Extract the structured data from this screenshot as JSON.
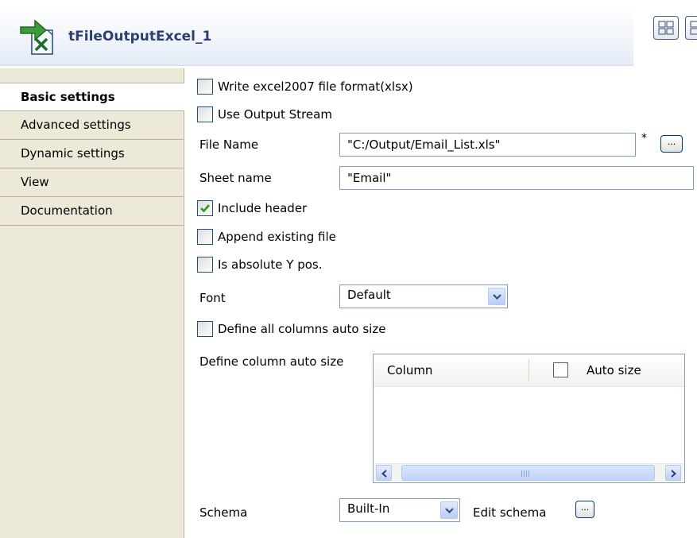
{
  "header": {
    "title": "tFileOutputExcel_1",
    "icons": [
      "component-icon",
      "layout-toggle-icon"
    ]
  },
  "tabs": [
    {
      "label": "Basic settings",
      "active": true
    },
    {
      "label": "Advanced settings",
      "active": false
    },
    {
      "label": "Dynamic settings",
      "active": false
    },
    {
      "label": "View",
      "active": false
    },
    {
      "label": "Documentation",
      "active": false
    }
  ],
  "form": {
    "write_excel2007": {
      "label": "Write excel2007 file format(xlsx)",
      "checked": false
    },
    "use_output_stream": {
      "label": "Use Output Stream",
      "checked": false
    },
    "file_name": {
      "label": "File Name",
      "value": "\"C:/Output/Email_List.xls\"",
      "required_mark": "*",
      "browse_label": "..."
    },
    "sheet_name": {
      "label": "Sheet name",
      "value": "\"Email\""
    },
    "include_header": {
      "label": "Include header",
      "checked": true
    },
    "append_existing": {
      "label": "Append existing file",
      "checked": false
    },
    "absolute_y": {
      "label": "Is absolute Y pos.",
      "checked": false
    },
    "font": {
      "label": "Font",
      "value": "Default"
    },
    "define_all_auto": {
      "label": "Define all columns auto size",
      "checked": false
    },
    "define_column_auto": {
      "label": "Define column auto size",
      "columns": [
        "Column",
        "Auto size"
      ]
    },
    "schema": {
      "label": "Schema",
      "value": "Built-In",
      "edit_label": "Edit schema",
      "edit_button_label": "..."
    }
  },
  "colors": {
    "tab_background": "#ece9d8",
    "title_text": "#2a3f74",
    "check_mark": "#21a121"
  }
}
